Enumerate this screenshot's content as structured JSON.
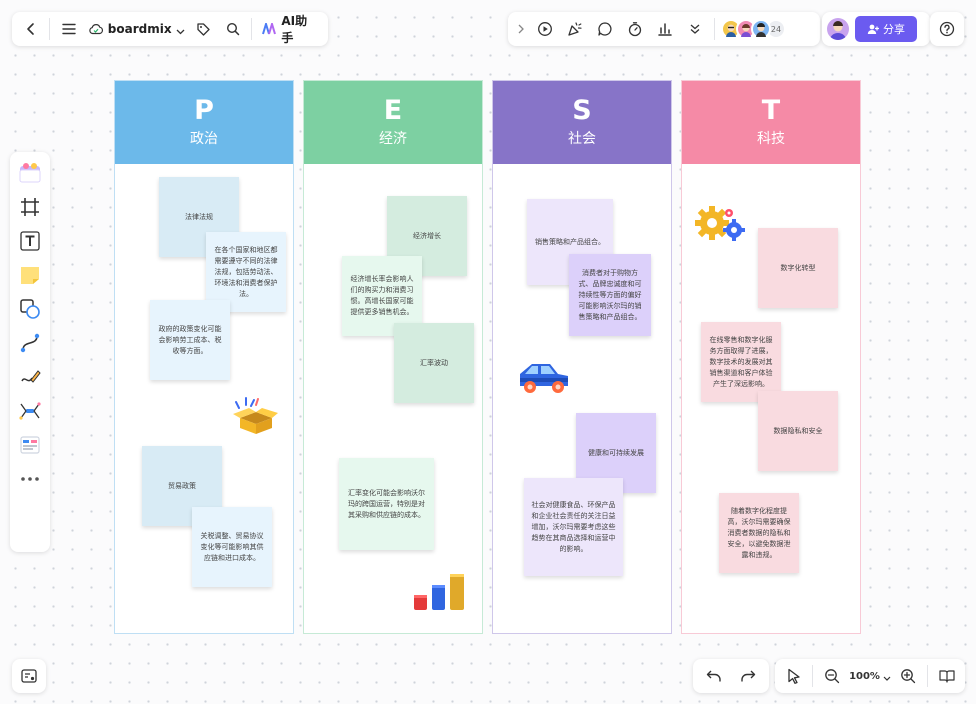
{
  "topbar": {
    "app_name": "boardmix",
    "ai_label": "AI助手",
    "collaborators_count": "24",
    "share_label": "分享"
  },
  "zoom": {
    "level": "100%"
  },
  "columns": [
    {
      "letter": "P",
      "name": "政治",
      "color": "#6cb9ea",
      "border": "#bfdff4"
    },
    {
      "letter": "E",
      "name": "经济",
      "color": "#7dd0a2",
      "border": "#c6ead6"
    },
    {
      "letter": "S",
      "name": "社会",
      "color": "#8774c8",
      "border": "#cfc7ea"
    },
    {
      "letter": "T",
      "name": "科技",
      "color": "#f58aa6",
      "border": "#f8cad6"
    }
  ],
  "notes": {
    "p": [
      "法律法规",
      "在各个国家和地区都需要遵守不同的法律法规，包括劳动法、环境法和消费者保护法。",
      "政府的政策变化可能会影响劳工成本、税收等方面。",
      "贸易政策",
      "关税调整、贸易协议变化等可能影响其供应链和进口成本。"
    ],
    "e": [
      "经济增长",
      "经济增长率会影响人们的购买力和消费习惯。高增长国家可能提供更多销售机会。",
      "汇率波动",
      "汇率变化可能会影响沃尔玛的跨国运营，特别是对其采购和供应链的成本。"
    ],
    "s": [
      "销售策略和产品组合。",
      "消费者对于购物方式、品牌忠诚度和可持续性等方面的偏好可能影响沃尔玛的销售策略和产品组合。",
      "健康和可持续发展",
      "社会对健康食品、环保产品和企业社会责任的关注日益增加，沃尔玛需要考虑这些趋势在其商品选择和运营中的影响。"
    ],
    "t": [
      "数字化转型",
      "在线零售和数字化服务方面取得了进展，数字技术的发展对其销售渠道和客户体验产生了深远影响。",
      "数据隐私和安全",
      "随着数字化程度提高，沃尔玛需要确保消费者数据的隐私和安全，以避免数据泄露和违规。"
    ]
  },
  "colors": {
    "share_button": "#6b5bf0",
    "note_blue": "#d8ebf5",
    "note_light_blue": "#e7f4fd",
    "note_green": "#d4ecdf",
    "note_light_green": "#e6f8ee",
    "note_lavender": "#ede6fb",
    "note_purple": "#dcd0fa",
    "note_pink": "#f9dbe0"
  }
}
